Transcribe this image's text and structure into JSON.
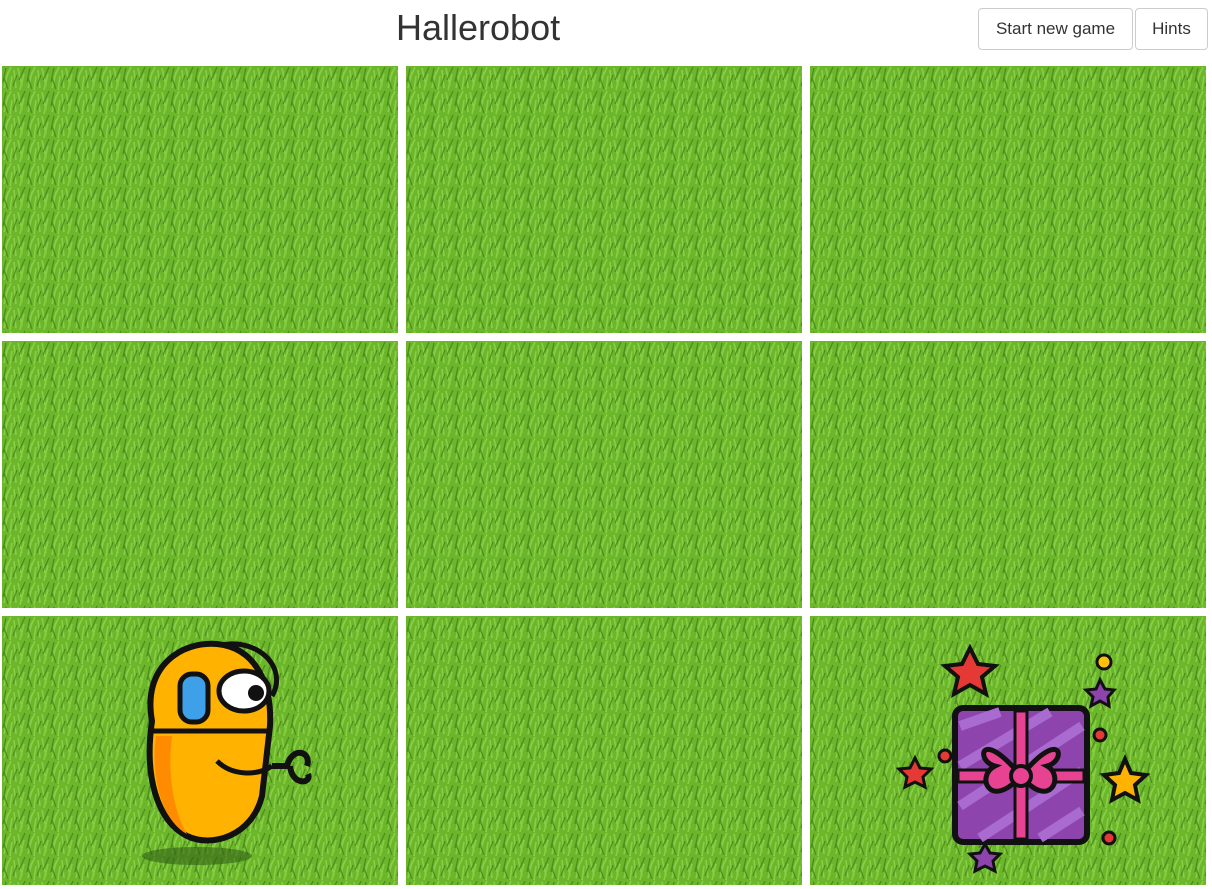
{
  "header": {
    "title": "Hallerobot",
    "start_button_label": "Start new game",
    "hints_button_label": "Hints"
  },
  "board": {
    "rows": 3,
    "cols": 3,
    "cells": [
      {
        "row": 1,
        "col": 1,
        "content": "grass"
      },
      {
        "row": 1,
        "col": 2,
        "content": "grass"
      },
      {
        "row": 1,
        "col": 3,
        "content": "grass"
      },
      {
        "row": 2,
        "col": 1,
        "content": "grass"
      },
      {
        "row": 2,
        "col": 2,
        "content": "grass"
      },
      {
        "row": 2,
        "col": 3,
        "content": "grass"
      },
      {
        "row": 3,
        "col": 1,
        "content": "robot-icon"
      },
      {
        "row": 3,
        "col": 2,
        "content": "grass"
      },
      {
        "row": 3,
        "col": 3,
        "content": "gift-icon"
      }
    ]
  },
  "colors": {
    "grass": "#6cb62c",
    "robot_body": "#ffb300",
    "gift_box": "#8e44ad",
    "gift_ribbon": "#e84393"
  }
}
